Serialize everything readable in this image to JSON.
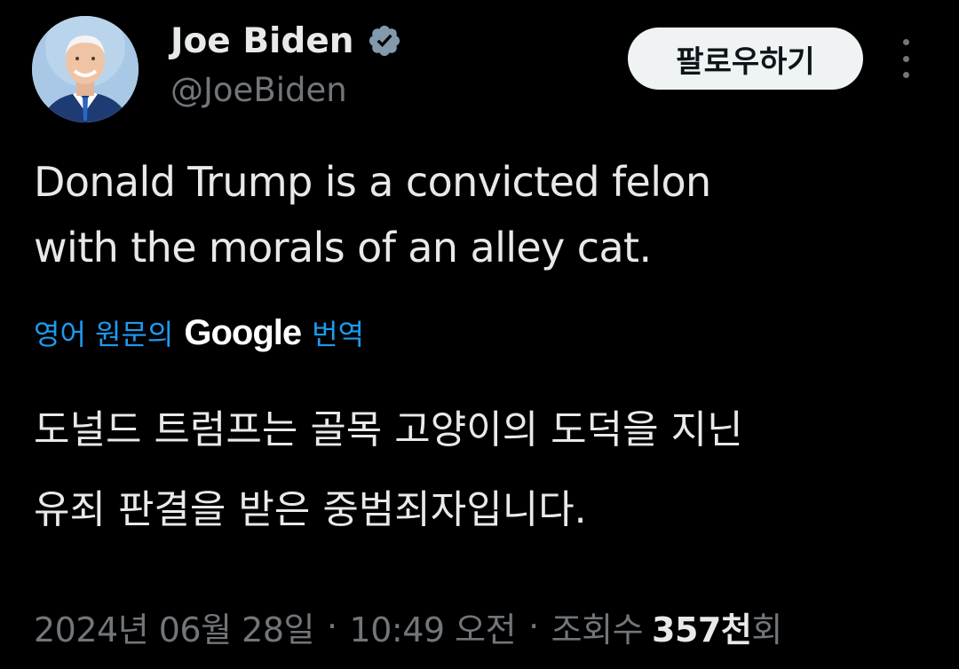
{
  "author": {
    "display_name": "Joe Biden",
    "handle": "@JoeBiden",
    "verified": true
  },
  "follow_button": {
    "label": "팔로우하기"
  },
  "tweet": {
    "text_lines": [
      "Donald Trump is a convicted felon",
      "with the morals of an alley cat."
    ]
  },
  "translation": {
    "prefix": "영어 원문의",
    "provider": "Google",
    "suffix": "번역",
    "text_lines": [
      "도널드 트럼프는 골목 고양이의 도덕을 지닌",
      "유죄 판결을 받은 중범죄자입니다."
    ]
  },
  "meta": {
    "date": "2024년 06월 28일",
    "separator": "·",
    "time": "10:49 오전",
    "views_label": "조회수",
    "views_count": "357천",
    "views_suffix": "회"
  },
  "colors": {
    "background": "#000000",
    "primary_text": "#e7e9ea",
    "secondary_text": "#71767b",
    "link": "#1d9bf0",
    "verified_badge": "#829aab",
    "follow_button_bg": "#eff3f4",
    "follow_button_text": "#0f1419"
  },
  "icons": {
    "verified": "verified-badge-icon",
    "more": "more-vertical-icon"
  }
}
